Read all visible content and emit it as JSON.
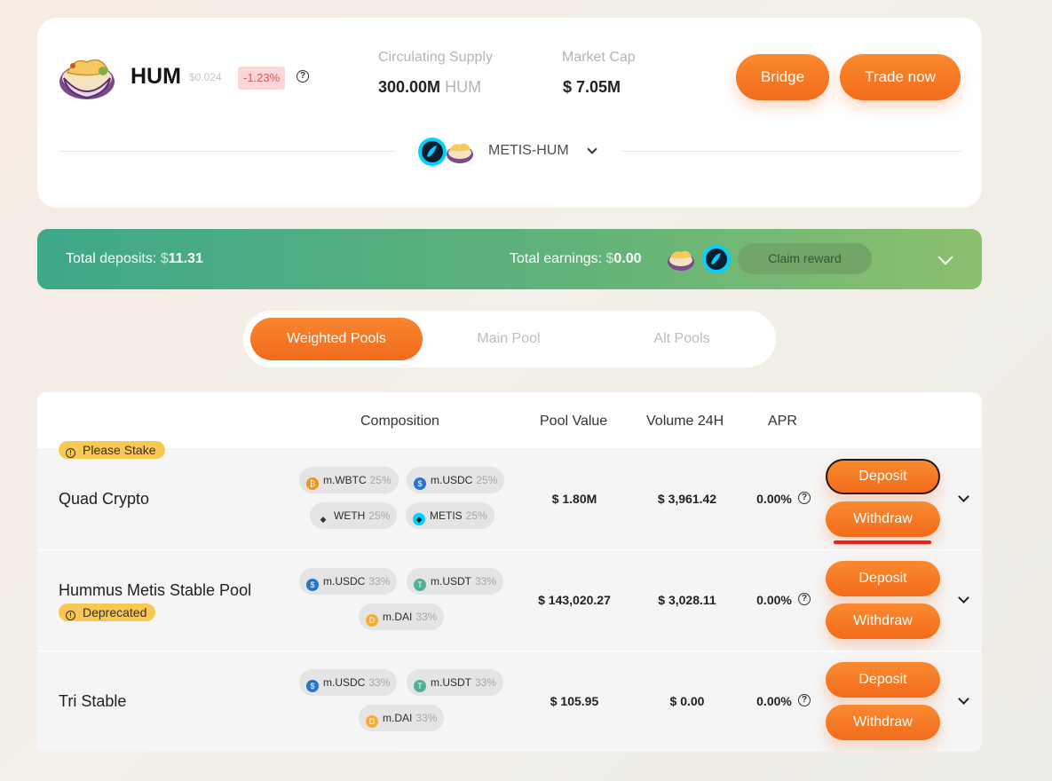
{
  "token": {
    "name": "HUM",
    "price": "$0.024",
    "change": "-1.23%",
    "help": "?"
  },
  "stats": {
    "supply_label": "Circulating Supply",
    "supply_value": "300.00M",
    "supply_unit": "HUM",
    "mcap_label": "Market Cap",
    "mcap_value": "$ 7.05M"
  },
  "actions": {
    "bridge": "Bridge",
    "trade": "Trade now"
  },
  "pair": {
    "label": "METIS-HUM"
  },
  "summary": {
    "deposits_label": "Total deposits:",
    "deposits_dollar": "$",
    "deposits_value": "11.31",
    "earnings_label": "Total earnings:",
    "earnings_dollar": "$",
    "earnings_value": "0.00",
    "claim": "Claim reward"
  },
  "tabs": [
    {
      "label": "Weighted Pools",
      "active": true
    },
    {
      "label": "Main Pool",
      "active": false
    },
    {
      "label": "Alt Pools",
      "active": false
    }
  ],
  "table": {
    "headers": [
      "Composition",
      "Pool Value",
      "Volume 24H",
      "APR"
    ],
    "rows": [
      {
        "tag": "Please Stake",
        "name": "Quad Crypto",
        "chips": [
          {
            "token": "m.WBTC",
            "pct": "25%"
          },
          {
            "token": "m.USDC",
            "pct": "25%"
          },
          {
            "token": "WETH",
            "pct": "25%"
          },
          {
            "token": "METIS",
            "pct": "25%"
          }
        ],
        "pool_value": "$ 1.80M",
        "volume": "$ 3,961.42",
        "apr": "0.00%",
        "deposit": "Deposit",
        "withdraw": "Withdraw"
      },
      {
        "tag": "Deprecated",
        "name": "Hummus Metis Stable Pool",
        "chips": [
          {
            "token": "m.USDC",
            "pct": "33%"
          },
          {
            "token": "m.USDT",
            "pct": "33%"
          },
          {
            "token": "m.DAI",
            "pct": "33%"
          }
        ],
        "pool_value": "$ 143,020.27",
        "volume": "$ 3,028.11",
        "apr": "0.00%",
        "deposit": "Deposit",
        "withdraw": "Withdraw"
      },
      {
        "name": "Tri Stable",
        "chips": [
          {
            "token": "m.USDC",
            "pct": "33%"
          },
          {
            "token": "m.USDT",
            "pct": "33%"
          },
          {
            "token": "m.DAI",
            "pct": "33%"
          }
        ],
        "pool_value": "$ 105.95",
        "volume": "$ 0.00",
        "apr": "0.00%",
        "deposit": "Deposit",
        "withdraw": "Withdraw"
      }
    ]
  },
  "colors": {
    "accent": "#f26b1c",
    "banner_start": "#3ea88a",
    "banner_end": "#8cc06e",
    "negative": "#e05555",
    "tag": "#f7c853"
  },
  "icons": {
    "hum": "hum-bowl-icon",
    "metis": "metis-icon",
    "help": "help-circle-icon",
    "expand": "chevron-down-icon",
    "wbtc": "bitcoin-icon",
    "usdc": "usdc-icon",
    "weth": "ethereum-icon",
    "usdt": "tether-icon",
    "dai": "dai-icon"
  }
}
